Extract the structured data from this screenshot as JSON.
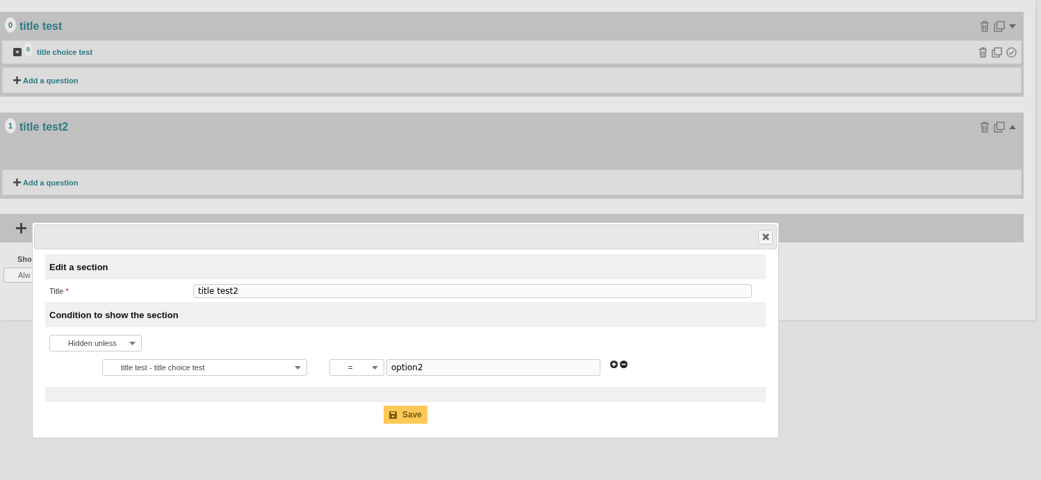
{
  "sections": [
    {
      "index": "0",
      "title": "title test",
      "expanded": true,
      "questions": [
        {
          "index": "0",
          "title": "title choice test"
        }
      ],
      "add_question": "Add a question"
    },
    {
      "index": "1",
      "title": "title test2",
      "expanded": false,
      "add_question": "Add a question"
    }
  ],
  "behind_modal": {
    "show_label": "Sho",
    "show_select": "Alw"
  },
  "modal": {
    "heading": "Edit a section",
    "title_label": "Title",
    "required_mark": "*",
    "title_value": "title test2",
    "condition_heading": "Condition to show the section",
    "mode": "Hidden unless",
    "condition": {
      "question": "title test - title choice test",
      "operator": "=",
      "value": "option2"
    },
    "save": "Save"
  }
}
